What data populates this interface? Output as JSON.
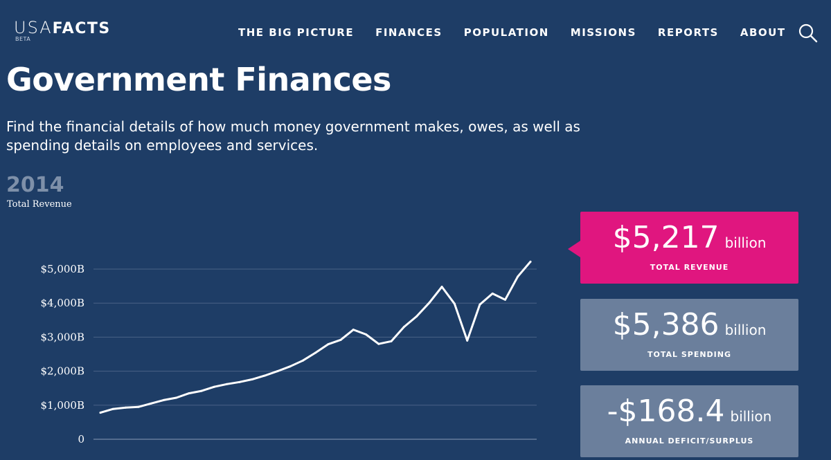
{
  "header": {
    "logo": {
      "usa": "USA",
      "facts": "FACTS",
      "beta": "BETA"
    },
    "nav": [
      {
        "label": "THE BIG PICTURE"
      },
      {
        "label": "FINANCES"
      },
      {
        "label": "POPULATION"
      },
      {
        "label": "MISSIONS"
      },
      {
        "label": "REPORTS"
      },
      {
        "label": "ABOUT"
      }
    ],
    "search_icon": "search-icon"
  },
  "main": {
    "title": "Government Finances",
    "subtitle": "Find the financial details of how much money government makes, owes, as well as spending details on employees and services.",
    "year": "2014",
    "metric_label": "Total Revenue"
  },
  "cards": [
    {
      "amount": "$5,217",
      "unit": "billion",
      "caption": "TOTAL REVENUE",
      "color": "#e0167f",
      "active": true
    },
    {
      "amount": "$5,386",
      "unit": "billion",
      "caption": "TOTAL SPENDING",
      "color": "#6b7f9c",
      "active": false
    },
    {
      "amount": "-$168.4",
      "unit": "billion",
      "caption": "ANNUAL DEFICIT/SURPLUS",
      "color": "#6b7f9c",
      "active": false
    }
  ],
  "colors": {
    "background": "#1e3d66",
    "accent": "#e0167f",
    "muted": "#6b7f9c",
    "line": "#ffffff",
    "grid": "#4a6286"
  },
  "chart_data": {
    "type": "line",
    "title": "",
    "xlabel": "",
    "ylabel": "",
    "y_tick_labels": [
      "0",
      "$1,000B",
      "$2,000B",
      "$3,000B",
      "$4,000B",
      "$5,000B"
    ],
    "y_ticks": [
      0,
      1000,
      2000,
      3000,
      4000,
      5000
    ],
    "ylim": [
      0,
      5000
    ],
    "grid": true,
    "legend": "none",
    "series": [
      {
        "values": [
          780,
          890,
          930,
          950,
          1050,
          1150,
          1220,
          1350,
          1420,
          1540,
          1620,
          1680,
          1760,
          1870,
          2000,
          2140,
          2310,
          2540,
          2790,
          2920,
          3220,
          3080,
          2800,
          2880,
          3300,
          3610,
          4010,
          4480,
          3980,
          2900,
          3960,
          4280,
          4100,
          4780,
          5217
        ]
      }
    ]
  }
}
